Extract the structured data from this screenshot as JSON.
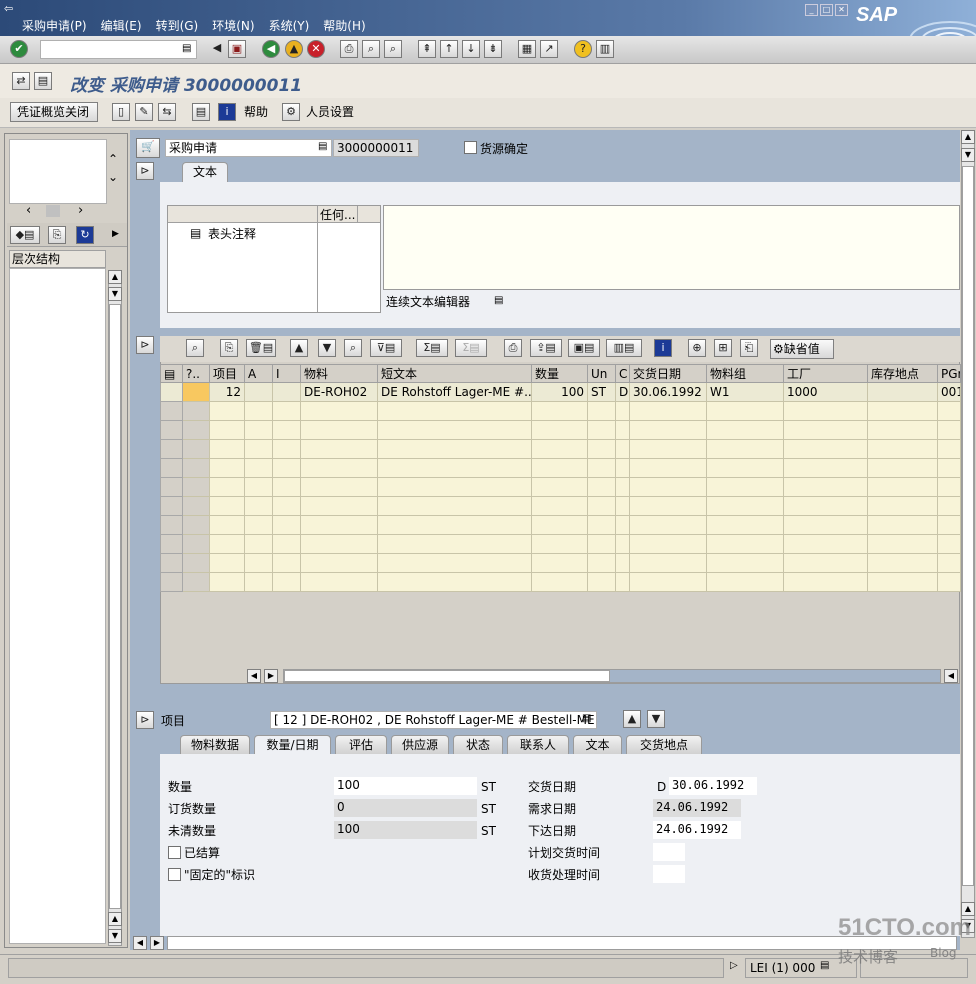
{
  "menu": {
    "items": [
      "采购申请(P)",
      "编辑(E)",
      "转到(G)",
      "环境(N)",
      "系统(Y)",
      "帮助(H)"
    ],
    "logo": "SAP"
  },
  "title": {
    "text": "改变 采购申请 3000000011"
  },
  "app_toolbar": {
    "overview_close": "凭证概览关闭",
    "help": "帮助",
    "personal_settings": "人员设置"
  },
  "left_panel": {
    "hierarchy_label": "层次结构"
  },
  "header": {
    "doc_type": "采购申请",
    "doc_number": "3000000011",
    "source_determination": "货源确定",
    "text_tab": "文本",
    "text_col2": "任何...",
    "text_item": "表头注释",
    "editor_label": "连续文本编辑器"
  },
  "grid": {
    "default_values_button": "缺省值",
    "columns": [
      "?..",
      "项目",
      "A",
      "I",
      "物料",
      "短文本",
      "数量",
      "Un",
      "C",
      "交货日期",
      "物料组",
      "工厂",
      "库存地点",
      "PGr"
    ],
    "rows": [
      [
        "",
        "12",
        "",
        "",
        "DE-ROH02",
        "DE Rohstoff Lager-ME #...",
        "100",
        "ST",
        "D",
        "30.06.1992",
        "W1",
        "1000",
        "",
        "001"
      ]
    ]
  },
  "item_detail": {
    "label": "项目",
    "selector": "[ 12 ] DE-ROH02 , DE Rohstoff Lager-ME # Bestell-ME",
    "tabs": [
      "物料数据",
      "数量/日期",
      "评估",
      "供应源",
      "状态",
      "联系人",
      "文本",
      "交货地点"
    ],
    "active_tab": "数量/日期",
    "qty_label": "数量",
    "qty_value": "100",
    "ordered_label": "订货数量",
    "ordered_value": "0",
    "open_label": "未清数量",
    "open_value": "100",
    "unit": "ST",
    "closed_label": "已结算",
    "fixed_label": "\"固定的\"标识",
    "delivery_label": "交货日期",
    "delivery_cat": "D",
    "delivery_value": "30.06.1992",
    "req_label": "需求日期",
    "req_value": "24.06.1992",
    "release_label": "下达日期",
    "release_value": "24.06.1992",
    "plan_time_label": "计划交货时间",
    "gr_time_label": "收货处理时间"
  },
  "status_bar": {
    "system": "LEI (1) 000"
  },
  "watermark": {
    "line1": "51CTO.com",
    "line2": "技术博客",
    "line3": "Blog"
  },
  "colors": {
    "background": "#d4d0c8",
    "panel_blue": "#a4b4c8",
    "title_bar": "#3e5c8c",
    "grid_bg": "#f8f4d8"
  }
}
